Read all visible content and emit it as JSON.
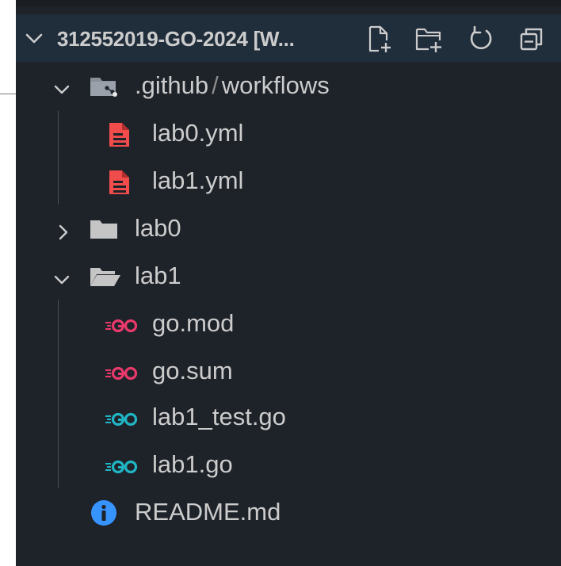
{
  "explorer": {
    "workspace_title": "312552019-GO-2024 [W...",
    "toolbar": {
      "new_file_icon": "new-file-icon",
      "new_folder_icon": "new-folder-icon",
      "refresh_icon": "refresh-icon",
      "collapse_icon": "collapse-all-icon"
    }
  },
  "tree": {
    "github": {
      "label_a": ".github",
      "separator": "/",
      "label_b": "workflows",
      "expanded": true,
      "children": [
        "lab0.yml",
        "lab1.yml"
      ]
    },
    "lab0": {
      "label": "lab0",
      "expanded": false
    },
    "lab1": {
      "label": "lab1",
      "expanded": true,
      "children": [
        "go.mod",
        "go.sum",
        "lab1_test.go",
        "lab1.go"
      ]
    },
    "readme": {
      "label": "README.md"
    }
  },
  "colors": {
    "panel_bg": "#1e2229",
    "header_bg": "#202d3b",
    "text": "#cccccc",
    "yaml_icon": "#f14c4c",
    "go_mod_icon": "#e8396b",
    "go_icon": "#20b4c4",
    "info_icon": "#3794ff",
    "folder_icon": "#c5c5c5"
  }
}
